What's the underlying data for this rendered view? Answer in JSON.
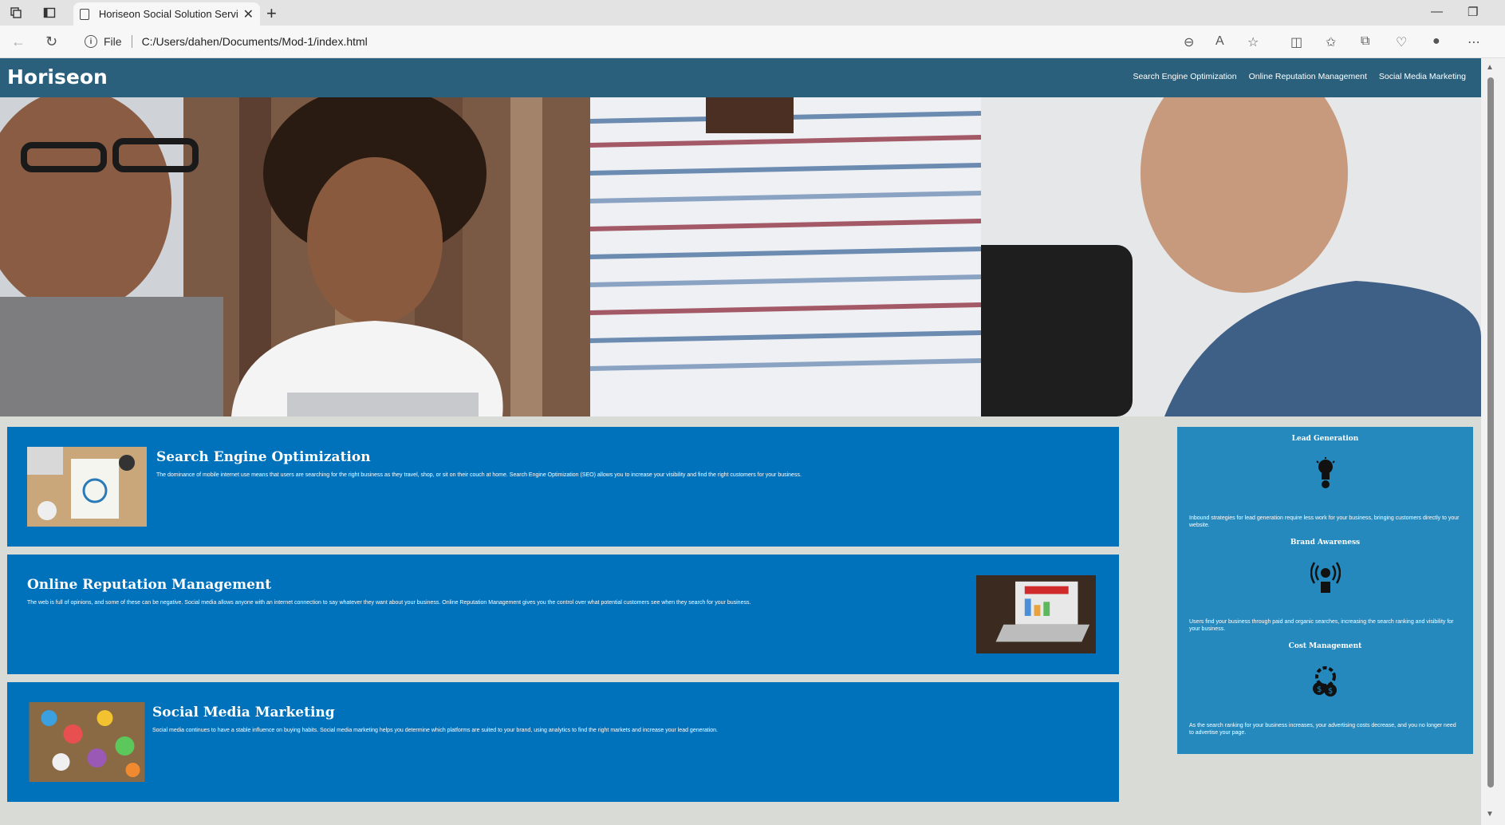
{
  "browser": {
    "tab_title": "Horiseon Social Solution Services",
    "address_prefix": "File",
    "url": "C:/Users/dahen/Documents/Mod-1/index.html"
  },
  "header": {
    "logo": "Horiseon",
    "nav": [
      "Search Engine Optimization",
      "Online Reputation Management",
      "Social Media Marketing"
    ]
  },
  "content": [
    {
      "title": "Search Engine Optimization",
      "text": "The dominance of mobile internet use means that users are searching for the right business as they travel, shop, or sit on their couch at home. Search Engine Optimization (SEO) allows you to increase your visibility and find the right customers for your business."
    },
    {
      "title": "Online Reputation Management",
      "text": "The web is full of opinions, and some of these can be negative. Social media allows anyone with an internet connection to say whatever they want about your business. Online Reputation Management gives you the control over what potential customers see when they search for your business."
    },
    {
      "title": "Social Media Marketing",
      "text": "Social media continues to have a stable influence on buying habits. Social media marketing helps you determine which platforms are suited to your brand, using analytics to find the right markets and increase your lead generation."
    }
  ],
  "benefits": [
    {
      "title": "Lead Generation",
      "icon": "lightbulb-icon",
      "text": "Inbound strategies for lead generation require less work for your business, bringing customers directly to your website."
    },
    {
      "title": "Brand Awareness",
      "icon": "broadcast-icon",
      "text": "Users find your business through paid and organic searches, increasing the search ranking and visibility for your business."
    },
    {
      "title": "Cost Management",
      "icon": "gear-money-icon",
      "text": "As the search ranking for your business increases, your advertising costs decrease, and you no longer need to advertise your page."
    }
  ],
  "colors": {
    "header": "#2a607c",
    "content_card": "#0072bb",
    "benefits": "#2589bd",
    "page_bg": "#d9dcd6"
  }
}
